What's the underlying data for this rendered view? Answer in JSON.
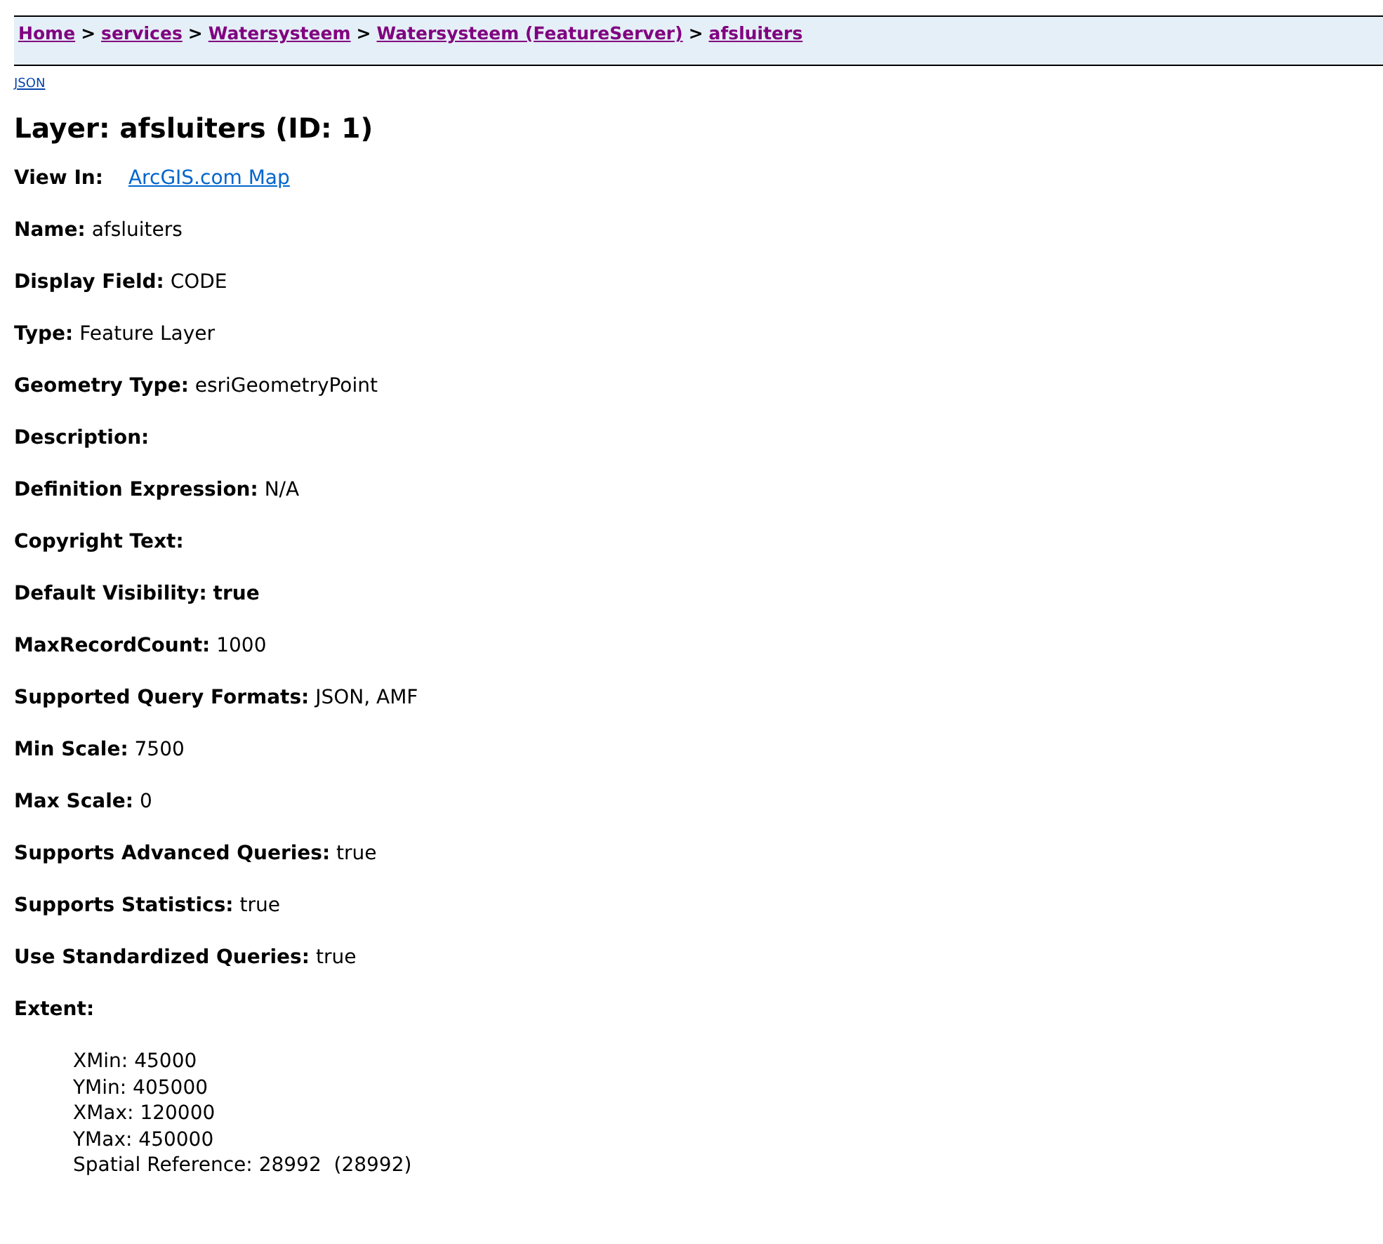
{
  "breadcrumb": [
    {
      "label": "Home"
    },
    {
      "label": "services"
    },
    {
      "label": "Watersysteem"
    },
    {
      "label": "Watersysteem (FeatureServer)"
    },
    {
      "label": "afsluiters"
    }
  ],
  "separator": ">",
  "format_link": "JSON",
  "heading": "Layer: afsluiters (ID: 1)",
  "view_in": {
    "label": "View In:",
    "link": "ArcGIS.com Map"
  },
  "fields": [
    {
      "label": "Name:",
      "value": "afsluiters",
      "emphasis": false
    },
    {
      "label": "Display Field:",
      "value": "CODE",
      "emphasis": false
    },
    {
      "label": "Type:",
      "value": "Feature Layer",
      "emphasis": false
    },
    {
      "label": "Geometry Type:",
      "value": "esriGeometryPoint",
      "emphasis": false
    },
    {
      "label": "Description:",
      "emphasis": false
    },
    {
      "label": "Definition Expression:",
      "value": "N/A",
      "emphasis": false
    },
    {
      "label": "Copyright Text:",
      "emphasis": false
    },
    {
      "label": "Default Visibility:",
      "value": "true",
      "emphasis": true
    },
    {
      "label": "MaxRecordCount:",
      "value": "1000",
      "emphasis": false
    },
    {
      "label": "Supported Query Formats:",
      "value": "JSON, AMF",
      "emphasis": false
    },
    {
      "label": "Min Scale:",
      "value": "7500",
      "emphasis": false
    },
    {
      "label": "Max Scale:",
      "value": "0",
      "emphasis": false
    },
    {
      "label": "Supports Advanced Queries:",
      "value": "true",
      "emphasis": false
    },
    {
      "label": "Supports Statistics:",
      "value": "true",
      "emphasis": false
    },
    {
      "label": "Use Standardized Queries:",
      "value": "true",
      "emphasis": false
    }
  ],
  "extent": {
    "label": "Extent:",
    "lines": [
      "XMin: 45000",
      "YMin: 405000",
      "XMax: 120000",
      "YMax: 450000",
      "Spatial Reference: 28992  (28992)"
    ]
  }
}
